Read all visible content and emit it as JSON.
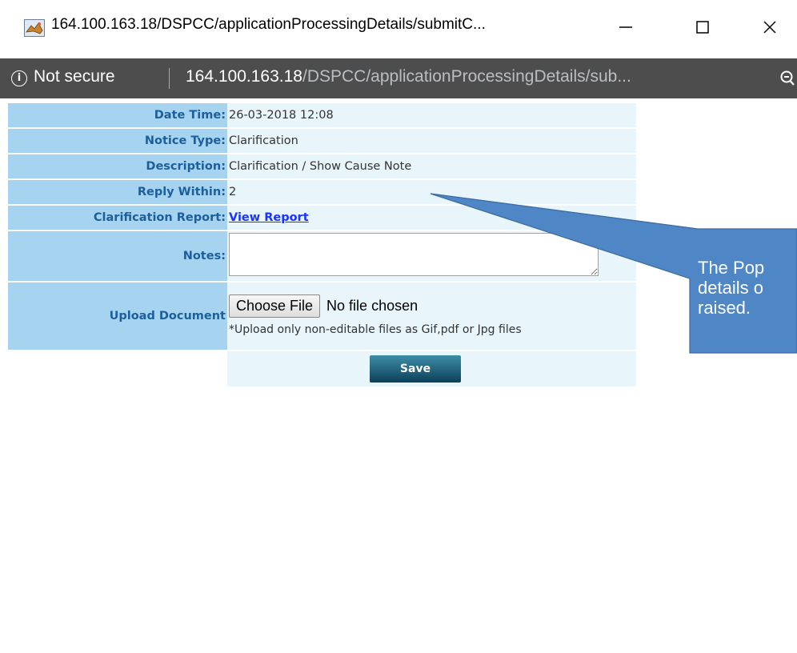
{
  "window": {
    "title": "164.100.163.18/DSPCC/applicationProcessingDetails/submitC...",
    "minimize_glyph": "—",
    "maximize_glyph": "☐",
    "close_glyph": "✕",
    "icon": "app-icon"
  },
  "addressbar": {
    "security_text": "Not secure",
    "url_host": "164.100.163.18",
    "url_path": "/DSPCC/applicationProcessingDetails/sub...",
    "info_glyph": "i",
    "zoom_glyph": "🔍"
  },
  "form": {
    "date_time": {
      "label": "Date Time:",
      "value": "26-03-2018 12:08"
    },
    "notice_type": {
      "label": "Notice Type:",
      "value": "Clarification"
    },
    "description": {
      "label": "Description:",
      "value": "Clarification / Show Cause Note"
    },
    "reply_within": {
      "label": "Reply Within:",
      "value": "2"
    },
    "clarification_report": {
      "label": "Clarification Report:",
      "link": "View Report"
    },
    "notes": {
      "label": "Notes:",
      "value": ""
    },
    "upload": {
      "label": "Upload Document",
      "button": "Choose File",
      "status": "No file chosen",
      "note": "*Upload only non-editable files as Gif,pdf or Jpg files"
    },
    "save_label": "Save"
  },
  "callout": {
    "lines": [
      "The Pop",
      "details o",
      "raised."
    ]
  },
  "colors": {
    "label_bg": "#a6d4f0",
    "label_text": "#1d5f9c",
    "value_bg": "#e8f5fb",
    "link": "#1a33ff",
    "addressbar_bg": "#4d4d4d",
    "callout_fill": "#4f86c6",
    "save_button": "#1a5a73"
  }
}
